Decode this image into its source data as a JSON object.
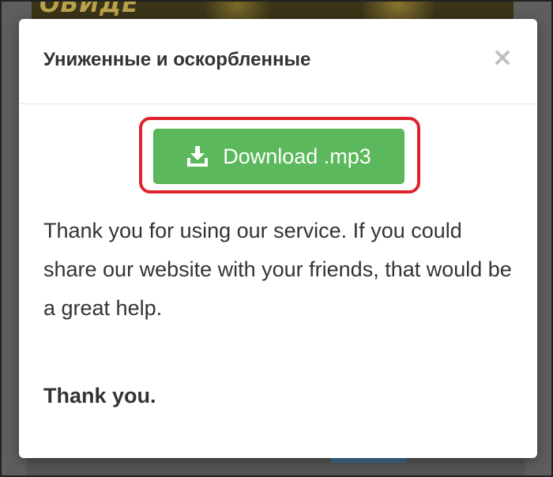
{
  "modal": {
    "title": "Униженные и оскорбленные",
    "close_label": "×",
    "download_button": {
      "label": "Download .mp3",
      "icon": "download-icon",
      "color": "#5cb85c"
    },
    "message": "Thank you for using our service. If you could share our website with your friends, that would be a great help.",
    "thanks": "Thank you."
  },
  "colors": {
    "highlight": "#e0232b",
    "text": "#333333",
    "overlay": "#5e5e5e"
  }
}
